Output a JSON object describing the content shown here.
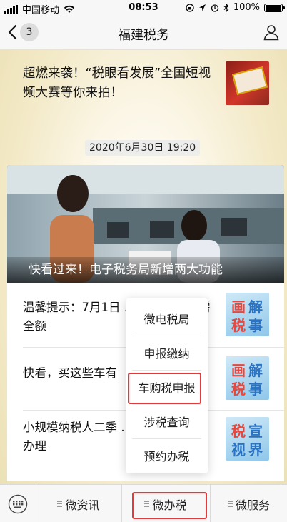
{
  "status_bar": {
    "carrier": "中国移动",
    "time": "08:53",
    "battery": "100%",
    "icons": [
      "signal-icon",
      "wifi-icon",
      "lock-rotation-icon",
      "navigation-icon",
      "alarm-icon",
      "bluetooth-icon",
      "battery-icon"
    ]
  },
  "nav": {
    "back_count": "3",
    "title": "福建税务",
    "icons": [
      "back-chevron-icon",
      "user-profile-icon"
    ]
  },
  "articles": {
    "top": {
      "title": "超燃来袭！“税眼看发展”全国短视频大赛等你来拍！"
    },
    "timestamp": "2020年6月30日 19:20",
    "feature": {
      "caption": "快看过来！电子税务局新增两大功能"
    },
    "list": [
      {
        "title": "温馨提示：7月1日 … 年城乡医保需全额",
        "thumb_chars": [
          "画",
          "解",
          "税",
          "事"
        ]
      },
      {
        "title": "快看，买这些车有",
        "thumb_chars": [
          "画",
          "解",
          "税",
          "事"
        ]
      },
      {
        "title": "小规模纳税人二季 … 具发票，如何办理",
        "thumb_chars": [
          "税",
          "宣",
          "视",
          "界"
        ]
      }
    ]
  },
  "popup_menu": {
    "items": [
      "微电税局",
      "申报缴纳",
      "车购税申报",
      "涉税查询",
      "预约办税"
    ],
    "highlighted": "车购税申报"
  },
  "bottom_bar": {
    "tabs": [
      "微资讯",
      "微办税",
      "微服务"
    ],
    "active_tab": "微办税",
    "icons": [
      "keyboard-icon",
      "menu-lines-icon"
    ]
  },
  "colors": {
    "highlight_border": "#e23a3a",
    "blue_thumb": "#8fc7ea",
    "red_thumb": "#d2362a"
  }
}
